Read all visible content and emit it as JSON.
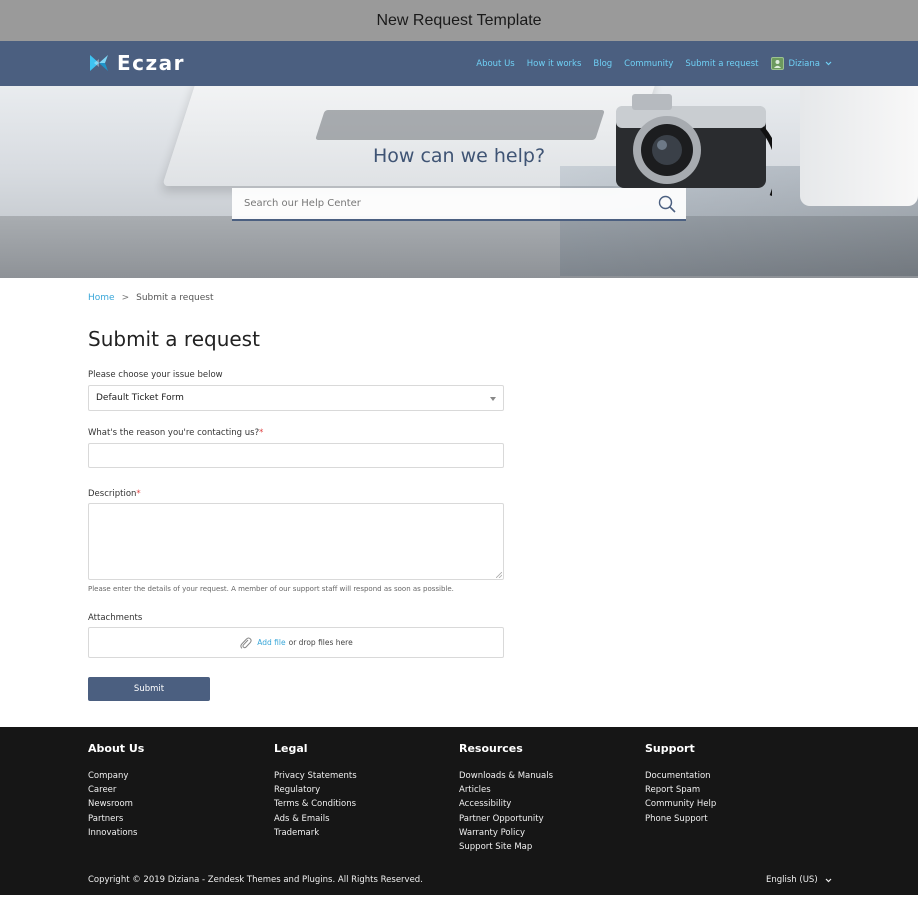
{
  "window": {
    "title": "New Request Template"
  },
  "header": {
    "brand": "Eczar",
    "nav": [
      "About Us",
      "How it works",
      "Blog",
      "Community",
      "Submit a request"
    ],
    "user_name": "Diziana"
  },
  "hero": {
    "title": "How can we help?",
    "search_placeholder": "Search our Help Center"
  },
  "breadcrumb": {
    "home": "Home",
    "separator": ">",
    "current": "Submit a request"
  },
  "form": {
    "title": "Submit a request",
    "issue_label": "Please choose your issue below",
    "issue_value": "Default Ticket Form",
    "reason_label": "What's the reason you're contacting us?",
    "description_label": "Description",
    "required_mark": "*",
    "description_hint": "Please enter the details of your request. A member of our support staff will respond as soon as possible.",
    "attachments_label": "Attachments",
    "add_file": "Add file",
    "drop_text": "or drop files here",
    "submit_label": "Submit"
  },
  "footer": {
    "columns": [
      {
        "heading": "About Us",
        "links": [
          "Company",
          "Career",
          "Newsroom",
          "Partners",
          "Innovations"
        ]
      },
      {
        "heading": "Legal",
        "links": [
          "Privacy Statements",
          "Regulatory",
          "Terms & Conditions",
          "Ads & Emails",
          "Trademark"
        ]
      },
      {
        "heading": "Resources",
        "links": [
          "Downloads & Manuals",
          "Articles",
          "Accessibility",
          "Partner Opportunity",
          "Warranty Policy",
          "Support Site Map"
        ]
      },
      {
        "heading": "Support",
        "links": [
          "Documentation",
          "Report Spam",
          "Community Help",
          "Phone Support"
        ]
      }
    ],
    "copyright": "Copyright © 2019 Diziana - Zendesk Themes and Plugins. All Rights Reserved.",
    "language": "English (US)"
  },
  "colors": {
    "header": "#4b5f80",
    "link": "#6fd0f5",
    "footer": "#161616",
    "accent": "#3aa7d9"
  }
}
